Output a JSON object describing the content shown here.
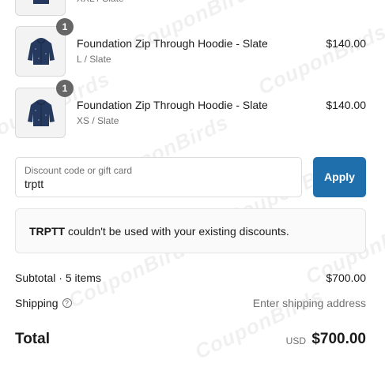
{
  "items": [
    {
      "title": "",
      "variant": "XXL / Slate",
      "price": "",
      "quantity": ""
    },
    {
      "title": "Foundation Zip Through Hoodie - Slate",
      "variant": "L / Slate",
      "price": "$140.00",
      "quantity": "1"
    },
    {
      "title": "Foundation Zip Through Hoodie - Slate",
      "variant": "XS / Slate",
      "price": "$140.00",
      "quantity": "1"
    }
  ],
  "discount": {
    "label": "Discount code or gift card",
    "value": "trptt",
    "apply_label": "Apply"
  },
  "error": {
    "code": "TRPTT",
    "message": " couldn't be used with your existing discounts."
  },
  "summary": {
    "subtotal_label": "Subtotal · 5 items",
    "subtotal_value": "$700.00",
    "shipping_label": "Shipping",
    "shipping_help": "?",
    "shipping_value": "Enter shipping address",
    "total_label": "Total",
    "total_currency": "USD",
    "total_value": "$700.00"
  },
  "watermark": "CouponBirds",
  "colors": {
    "accent": "#1f6fac",
    "badge": "#666666",
    "hoodie": "#253a5e",
    "muted_text": "#707070"
  },
  "icons": {
    "product_image": "hoodie-icon",
    "help": "question-circle-icon"
  }
}
